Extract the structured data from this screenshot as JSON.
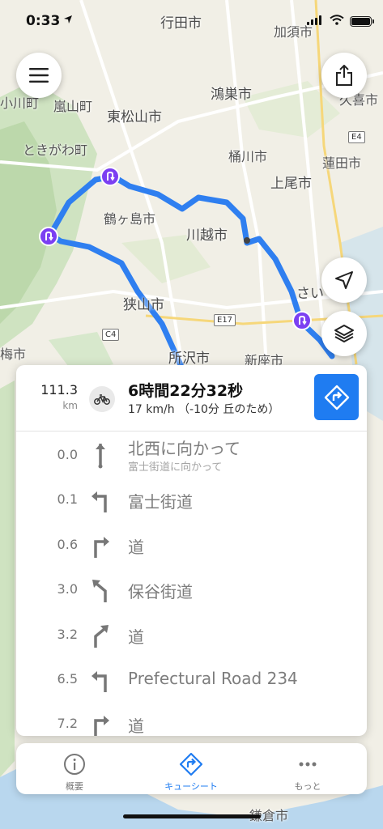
{
  "status_bar": {
    "time": "0:33"
  },
  "map": {
    "labels": [
      {
        "id": "gyoda",
        "text": "行田市"
      },
      {
        "id": "kazo",
        "text": "加須市"
      },
      {
        "id": "ogawa",
        "text": "小川町"
      },
      {
        "id": "ranzan",
        "text": "嵐山町"
      },
      {
        "id": "higashimatsuyama",
        "text": "東松山市"
      },
      {
        "id": "konosu",
        "text": "鴻巣市"
      },
      {
        "id": "kuki",
        "text": "久喜市"
      },
      {
        "id": "tokigawa",
        "text": "ときがわ町"
      },
      {
        "id": "okegawa",
        "text": "桶川市"
      },
      {
        "id": "hasuda",
        "text": "蓮田市"
      },
      {
        "id": "ageo",
        "text": "上尾市"
      },
      {
        "id": "tsurugashima",
        "text": "鶴ヶ島市"
      },
      {
        "id": "kawagoe",
        "text": "川越市"
      },
      {
        "id": "saitama",
        "text": "さい"
      },
      {
        "id": "sayama",
        "text": "狭山市"
      },
      {
        "id": "tokorozawa",
        "text": "所沢市"
      },
      {
        "id": "niiza",
        "text": "新座市"
      },
      {
        "id": "ome",
        "text": "梅市"
      },
      {
        "id": "kamakura",
        "text": "鎌倉市"
      }
    ],
    "road_signs": [
      {
        "id": "e4",
        "text": "E4"
      },
      {
        "id": "e17",
        "text": "E17"
      },
      {
        "id": "c4",
        "text": "C4"
      }
    ]
  },
  "summary": {
    "distance": "111.3",
    "distance_unit": "km",
    "duration": "6時間22分32秒",
    "speed": "17 km/h （-10分 丘のため）"
  },
  "cues": [
    {
      "dist": "0.0",
      "text": "北西に向かって",
      "sub": "富士街道に向かって",
      "icon": "straight-arrow-icon"
    },
    {
      "dist": "0.1",
      "text": "富士街道",
      "icon": "turn-left-icon"
    },
    {
      "dist": "0.6",
      "text": "道",
      "icon": "turn-right-icon"
    },
    {
      "dist": "3.0",
      "text": "保谷街道",
      "icon": "slight-left-icon"
    },
    {
      "dist": "3.2",
      "text": "道",
      "icon": "slight-right-icon"
    },
    {
      "dist": "6.5",
      "text": "Prefectural Road 234",
      "icon": "turn-left-icon"
    },
    {
      "dist": "7.2",
      "text": "道",
      "icon": "turn-right-icon"
    }
  ],
  "tabs": [
    {
      "label": "概要",
      "icon": "info-icon",
      "active": false
    },
    {
      "label": "キューシート",
      "icon": "directions-icon",
      "active": true
    },
    {
      "label": "もっと",
      "icon": "more-icon",
      "active": false
    }
  ],
  "colors": {
    "accent": "#1f7cf1",
    "route": "#2f7ff0",
    "poi": "#7b3ff2"
  }
}
